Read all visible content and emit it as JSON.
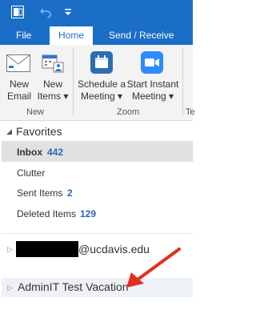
{
  "ribbon_tabs": [
    "File",
    "Home",
    "Send / Receive"
  ],
  "ribbon": {
    "new_email": [
      "New",
      "Email"
    ],
    "new_items": [
      "New",
      "Items ▾"
    ],
    "group_new": "New",
    "schedule": [
      "Schedule a",
      "Meeting ▾"
    ],
    "start_instant": [
      "Start Instant",
      "Meeting ▾"
    ],
    "group_zoom": "Zoom",
    "clipped_group": "Te"
  },
  "favorites": {
    "header": "Favorites",
    "items": [
      {
        "label": "Inbox",
        "count": "442"
      },
      {
        "label": "Clutter",
        "count": ""
      },
      {
        "label": "Sent Items",
        "count": "2"
      },
      {
        "label": "Deleted Items",
        "count": "129"
      }
    ]
  },
  "accounts": {
    "email_domain": "@ucdavis.edu",
    "shared_mailbox": "AdminIT Test Vacation"
  },
  "colors": {
    "ribbon_blue": "#1a6ec6",
    "zoom_blue": "#2d8cff",
    "arrow_red": "#e0301e"
  }
}
